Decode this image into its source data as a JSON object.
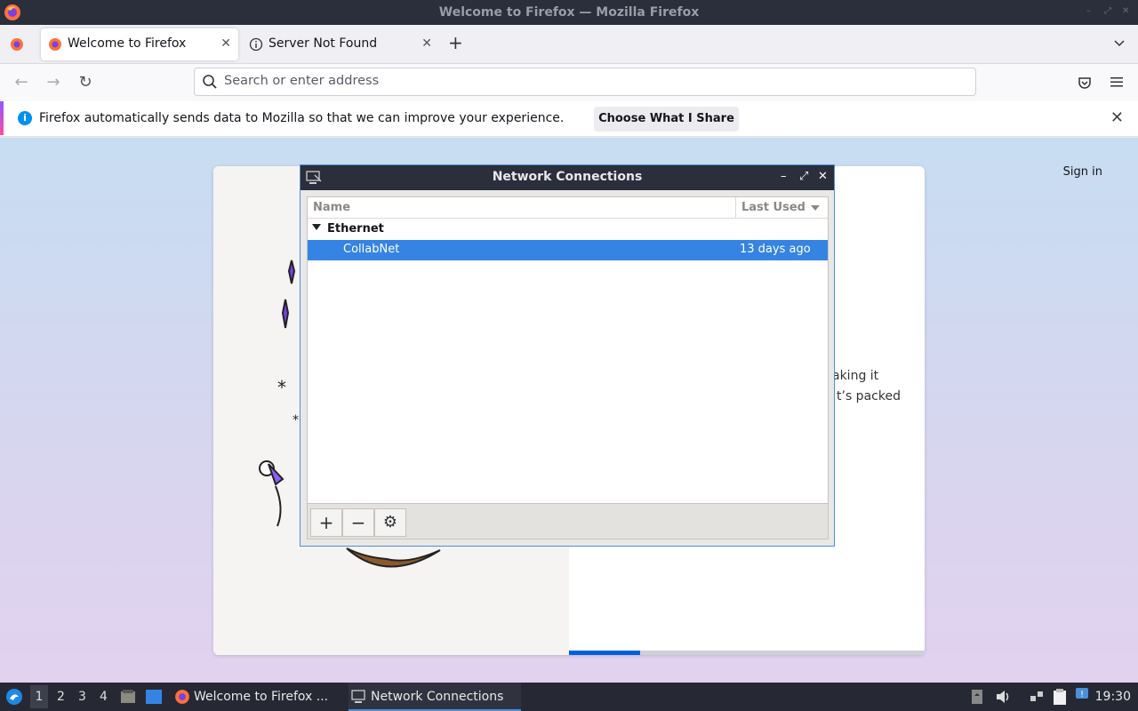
{
  "window": {
    "title": "Welcome to Firefox — Mozilla Firefox"
  },
  "tabs": [
    {
      "label": "Welcome to Firefox",
      "icon": "firefox-icon",
      "active": true
    },
    {
      "label": "Server Not Found",
      "icon": "info-icon",
      "active": false
    }
  ],
  "navbar": {
    "url_placeholder": "Search or enter address"
  },
  "notification": {
    "message": "Firefox automatically sends data to Mozilla so that we can improve your experience.",
    "button_label": "Choose What I Share"
  },
  "page": {
    "signin_label": "Sign in",
    "partial_text_line1": "aking it",
    "partial_text_line2": "t’s packed",
    "progress_fraction": 0.2
  },
  "dialog": {
    "title": "Network Connections",
    "columns": {
      "name": "Name",
      "last_used": "Last Used"
    },
    "group": {
      "label": "Ethernet"
    },
    "connection": {
      "name": "CollabNet",
      "last_used": "13 days ago"
    },
    "toolbar": {
      "add": "+",
      "remove": "−",
      "settings": "⚙"
    }
  },
  "taskbar": {
    "workspaces": [
      "1",
      "2",
      "3",
      "4"
    ],
    "tasks": [
      {
        "label": "Welcome to Firefox ..."
      },
      {
        "label": "Network Connections"
      }
    ],
    "clock": "19:30"
  }
}
